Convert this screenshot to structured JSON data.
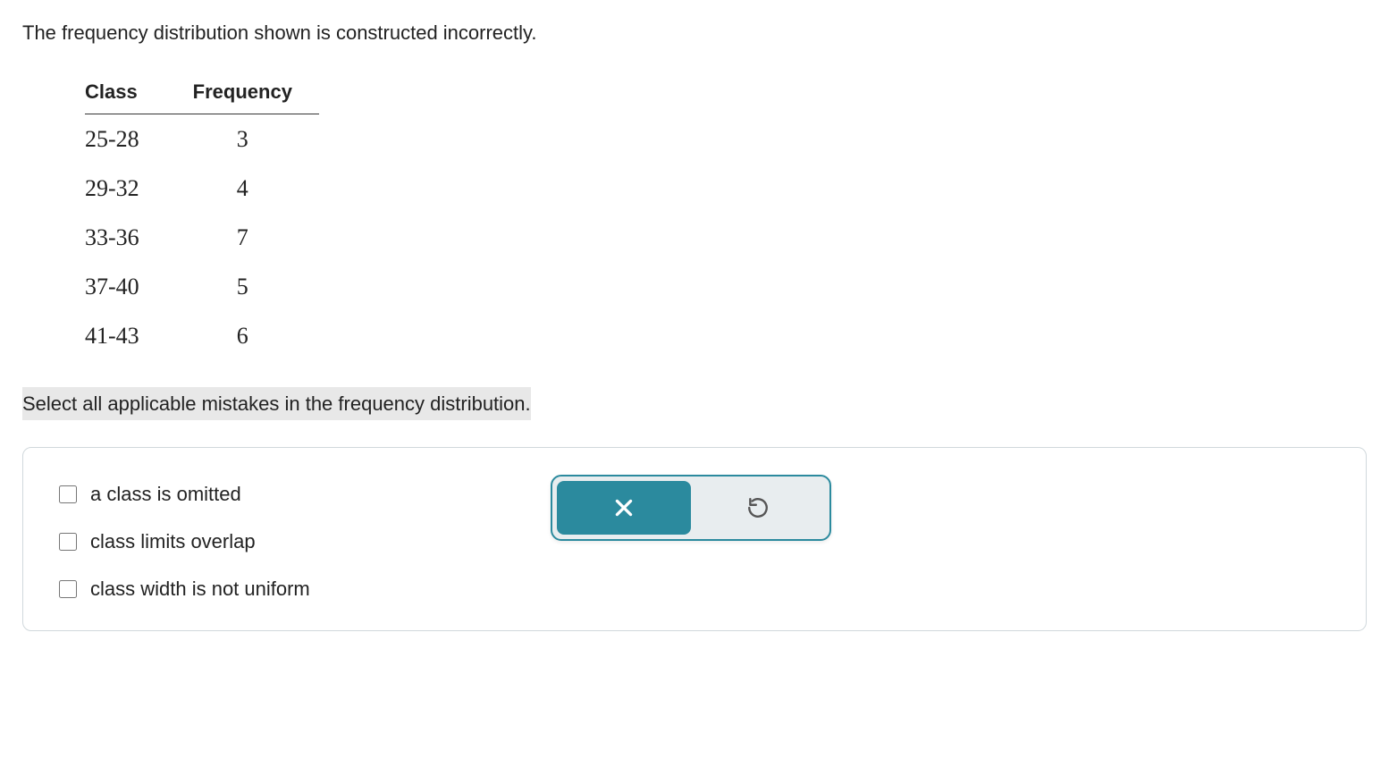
{
  "question": "The frequency distribution shown is constructed incorrectly.",
  "table": {
    "headers": {
      "col1": "Class",
      "col2": "Frequency"
    },
    "rows": [
      {
        "class": "25-28",
        "freq": "3"
      },
      {
        "class": "29-32",
        "freq": "4"
      },
      {
        "class": "33-36",
        "freq": "7"
      },
      {
        "class": "37-40",
        "freq": "5"
      },
      {
        "class": "41-43",
        "freq": "6"
      }
    ]
  },
  "instruction": "Select all applicable mistakes in the frequency distribution.",
  "options": [
    {
      "label": "a class is omitted"
    },
    {
      "label": "class limits overlap"
    },
    {
      "label": "class width is not uniform"
    }
  ],
  "feedback": {
    "status": "incorrect"
  }
}
